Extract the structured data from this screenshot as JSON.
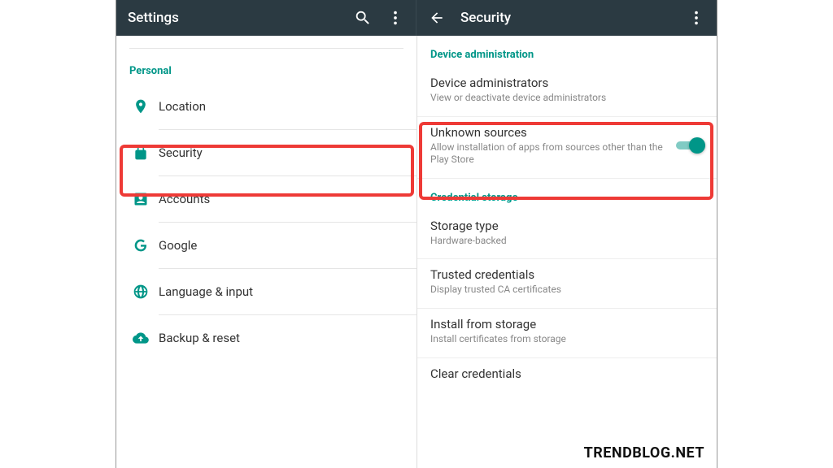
{
  "appbar_left": {
    "title": "Settings"
  },
  "appbar_right": {
    "title": "Security"
  },
  "left": {
    "section": "Personal",
    "items": [
      {
        "label": "Location"
      },
      {
        "label": "Security"
      },
      {
        "label": "Accounts"
      },
      {
        "label": "Google"
      },
      {
        "label": "Language & input"
      },
      {
        "label": "Backup & reset"
      }
    ]
  },
  "right": {
    "section1": "Device administration",
    "dev_admin": {
      "title": "Device administrators",
      "sub": "View or deactivate device administrators"
    },
    "unknown": {
      "title": "Unknown sources",
      "sub": "Allow installation of apps from sources other than the Play Store"
    },
    "section2": "Credential storage",
    "storage_type": {
      "title": "Storage type",
      "sub": "Hardware-backed"
    },
    "trusted": {
      "title": "Trusted credentials",
      "sub": "Display trusted CA certificates"
    },
    "install": {
      "title": "Install from storage",
      "sub": "Install certificates from storage"
    },
    "clear": {
      "title": "Clear credentials"
    }
  },
  "watermark": "TRENDBLOG.NET"
}
